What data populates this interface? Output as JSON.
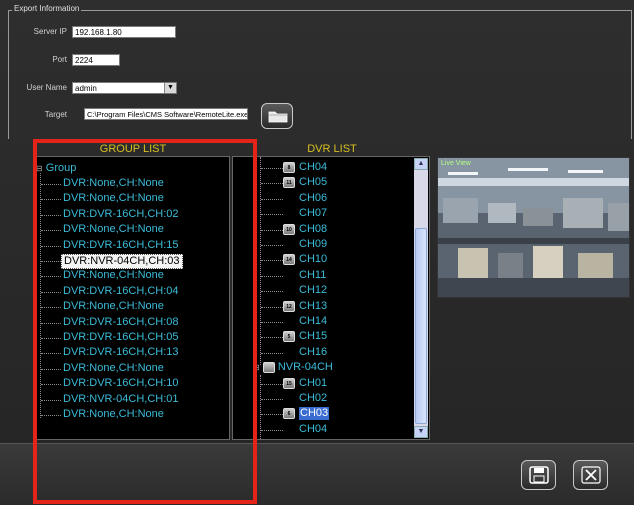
{
  "export": {
    "legend": "Export Information",
    "server_ip_label": "Server IP",
    "server_ip_value": "192.168.1.80",
    "port_label": "Port",
    "port_value": "2224",
    "user_name_label": "User Name",
    "user_name_value": "admin",
    "target_label": "Target",
    "target_value": "C:\\Program Files\\CMS Software\\RemoteLite.exe"
  },
  "group_list": {
    "title": "GROUP LIST",
    "root": "Group",
    "items": [
      "DVR:None,CH:None",
      "DVR:None,CH:None",
      "DVR:DVR-16CH,CH:02",
      "DVR:None,CH:None",
      "DVR:DVR-16CH,CH:15",
      "DVR:NVR-04CH,CH:03",
      "DVR:None,CH:None",
      "DVR:DVR-16CH,CH:04",
      "DVR:None,CH:None",
      "DVR:DVR-16CH,CH:08",
      "DVR:DVR-16CH,CH:05",
      "DVR:DVR-16CH,CH:13",
      "DVR:None,CH:None",
      "DVR:DVR-16CH,CH:10",
      "DVR:NVR-04CH,CH:01",
      "DVR:None,CH:None"
    ],
    "highlighted_index": 5
  },
  "dvr_list": {
    "title": "DVR LIST",
    "channels_a": [
      {
        "label": "CH04",
        "icon": "8"
      },
      {
        "label": "CH05",
        "icon": "11"
      },
      {
        "label": "CH06",
        "icon": ""
      },
      {
        "label": "CH07",
        "icon": ""
      },
      {
        "label": "CH08",
        "icon": "10"
      },
      {
        "label": "CH09",
        "icon": ""
      },
      {
        "label": "CH10",
        "icon": "14"
      },
      {
        "label": "CH11",
        "icon": ""
      },
      {
        "label": "CH12",
        "icon": ""
      },
      {
        "label": "CH13",
        "icon": "12"
      },
      {
        "label": "CH14",
        "icon": ""
      },
      {
        "label": "CH15",
        "icon": "5"
      },
      {
        "label": "CH16",
        "icon": ""
      }
    ],
    "device": "NVR-04CH",
    "channels_b": [
      {
        "label": "CH01",
        "icon": "15"
      },
      {
        "label": "CH02",
        "icon": ""
      },
      {
        "label": "CH03",
        "icon": "6"
      },
      {
        "label": "CH04",
        "icon": ""
      }
    ],
    "selected": "CH03"
  },
  "live_view": {
    "label": "Live View"
  },
  "colors": {
    "accent_title": "#d8c020",
    "tree_text": "#3cbcd8",
    "highlight_box": "#e42418"
  }
}
